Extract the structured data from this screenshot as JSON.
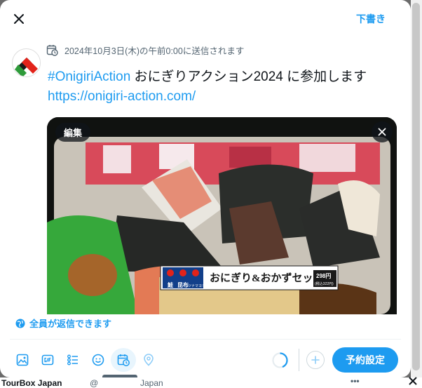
{
  "header": {
    "drafts_label": "下書き"
  },
  "schedule": {
    "text": "2024年10月3日(木)の午前0:00に送信されます"
  },
  "tweet": {
    "hashtag": "#OnigiriAction",
    "body": " おにぎりアクション2024 に参加します",
    "url": "https://onigiri-action.com/"
  },
  "media": {
    "edit_label": "編集",
    "label_text": "おにぎり&おかずセット",
    "price": "298円",
    "price_tax": "(税込322円)",
    "small_labels": [
      "鮭",
      "昆布",
      "ツナマヨネーズ"
    ]
  },
  "reply": {
    "label": "全員が返信できます"
  },
  "toolbar": {
    "tooltip": "予約設定",
    "primary_label": "予約設定"
  },
  "background": {
    "name": "TourBox Japan",
    "handle_left": "@",
    "handle_right": "Japan",
    "more": "•••"
  },
  "colors": {
    "accent": "#1d9bf0",
    "text": "#0f1419",
    "muted": "#536471"
  }
}
